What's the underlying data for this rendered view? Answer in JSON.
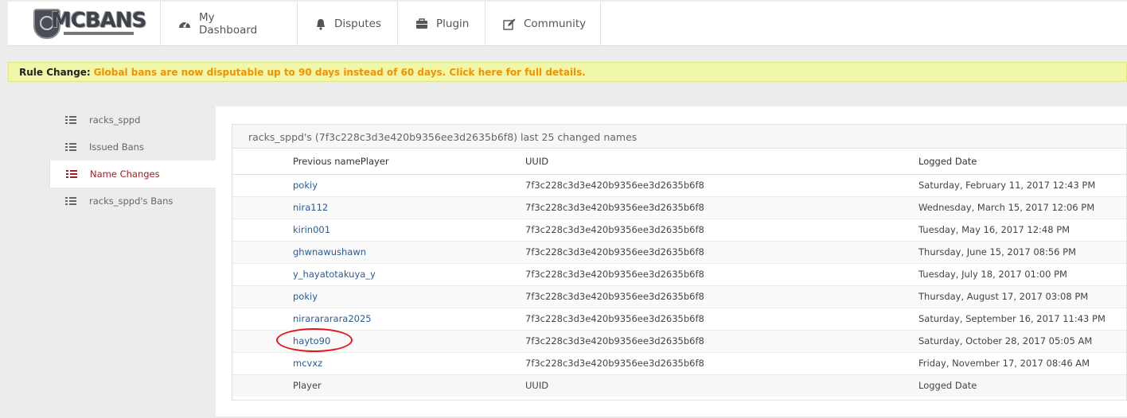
{
  "header": {
    "logo_text": "MCBANS",
    "nav": [
      {
        "label": "My Dashboard",
        "icon": "dashboard-icon"
      },
      {
        "label": "Disputes",
        "icon": "bell-icon"
      },
      {
        "label": "Plugin",
        "icon": "briefcase-icon"
      },
      {
        "label": "Community",
        "icon": "edit-icon"
      }
    ]
  },
  "notice": {
    "prefix": "Rule Change:",
    "message": "Global bans are now disputable up to 90 days instead of 60 days. Click here for full details."
  },
  "sidebar": {
    "items": [
      {
        "label": "racks_sppd",
        "active": false
      },
      {
        "label": "Issued Bans",
        "active": false
      },
      {
        "label": "Name Changes",
        "active": true
      },
      {
        "label": "racks_sppd's Bans",
        "active": false
      }
    ]
  },
  "panel": {
    "title": "racks_sppd's (7f3c228c3d3e420b9356ee3d2635b6f8) last 25 changed names",
    "columns": [
      "Previous namePlayer",
      "UUID",
      "Logged Date"
    ],
    "footer_columns": [
      "Player",
      "UUID",
      "Logged Date"
    ],
    "rows": [
      {
        "player": "pokiy",
        "uuid": "7f3c228c3d3e420b9356ee3d2635b6f8",
        "date": "Saturday, February 11, 2017 12:43 PM"
      },
      {
        "player": "nira112",
        "uuid": "7f3c228c3d3e420b9356ee3d2635b6f8",
        "date": "Wednesday, March 15, 2017 12:06 PM"
      },
      {
        "player": "kirin001",
        "uuid": "7f3c228c3d3e420b9356ee3d2635b6f8",
        "date": "Tuesday, May 16, 2017 12:48 PM"
      },
      {
        "player": "ghwnawushawn",
        "uuid": "7f3c228c3d3e420b9356ee3d2635b6f8",
        "date": "Thursday, June 15, 2017 08:56 PM"
      },
      {
        "player": "y_hayatotakuya_y",
        "uuid": "7f3c228c3d3e420b9356ee3d2635b6f8",
        "date": "Tuesday, July 18, 2017 01:00 PM"
      },
      {
        "player": "pokiy",
        "uuid": "7f3c228c3d3e420b9356ee3d2635b6f8",
        "date": "Thursday, August 17, 2017 03:08 PM"
      },
      {
        "player": "nirarararara2025",
        "uuid": "7f3c228c3d3e420b9356ee3d2635b6f8",
        "date": "Saturday, September 16, 2017 11:43 PM"
      },
      {
        "player": "hayto90",
        "uuid": "7f3c228c3d3e420b9356ee3d2635b6f8",
        "date": "Saturday, October 28, 2017 05:05 AM",
        "highlighted": true
      },
      {
        "player": "mcvxz",
        "uuid": "7f3c228c3d3e420b9356ee3d2635b6f8",
        "date": "Friday, November 17, 2017 08:46 AM"
      }
    ]
  },
  "colors": {
    "accent": "#a11e22",
    "link": "#2a5a9a",
    "notice_text": "#f39200",
    "annotation": "#e8141b"
  }
}
